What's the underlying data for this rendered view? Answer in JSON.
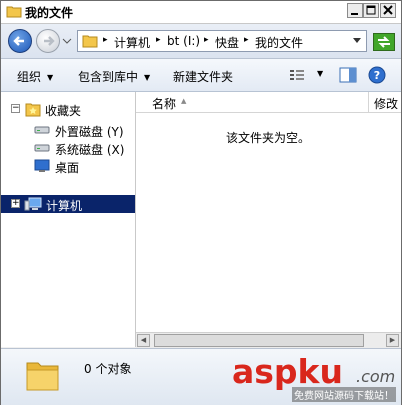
{
  "window": {
    "title": "我的文件"
  },
  "address": {
    "crumbs": [
      "计算机",
      "bt (I:)",
      "快盘",
      "我的文件"
    ]
  },
  "toolbar": {
    "organize": "组织",
    "include_in_library": "包含到库中",
    "new_folder": "新建文件夹"
  },
  "nav": {
    "favorites": "收藏夹",
    "items": [
      {
        "label": "外置磁盘 (Y)",
        "icon": "drive-icon"
      },
      {
        "label": "系统磁盘 (X)",
        "icon": "drive-icon"
      },
      {
        "label": "桌面",
        "icon": "desktop-icon"
      }
    ],
    "computer": "计算机"
  },
  "columns": {
    "name": "名称",
    "modified": "修改"
  },
  "content": {
    "empty_message": "该文件夹为空。"
  },
  "status": {
    "count_text": "0 个对象"
  },
  "watermark": {
    "brand": "aspku",
    "com": ".com",
    "sub": "免费网站源码下载站！"
  },
  "colors": {
    "selection": "#0a246a",
    "brand_red": "#d9271c"
  }
}
